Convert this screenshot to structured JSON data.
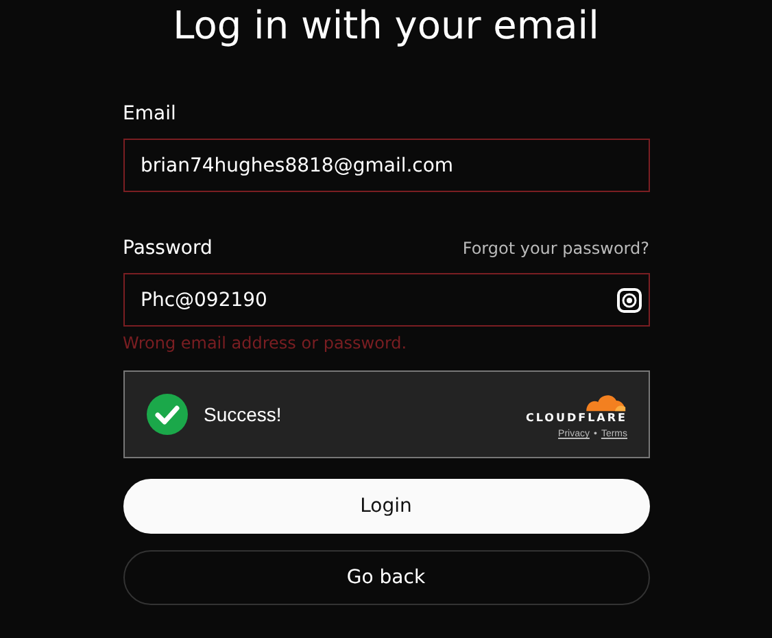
{
  "title": "Log in with your email",
  "email": {
    "label": "Email",
    "value": "brian74hughes8818@gmail.com",
    "error": true
  },
  "password": {
    "label": "Password",
    "value": "Phc@092190",
    "error": true,
    "forgot_link": "Forgot your password?"
  },
  "error_message": "Wrong email address or password.",
  "captcha": {
    "verified": true,
    "status": "Success!",
    "brand": "CLOUDFLARE",
    "privacy": "Privacy",
    "separator": "•",
    "terms": "Terms"
  },
  "buttons": [
    {
      "label": "Login",
      "kind": "primary"
    },
    {
      "label": "Go back",
      "kind": "secondary"
    }
  ]
}
